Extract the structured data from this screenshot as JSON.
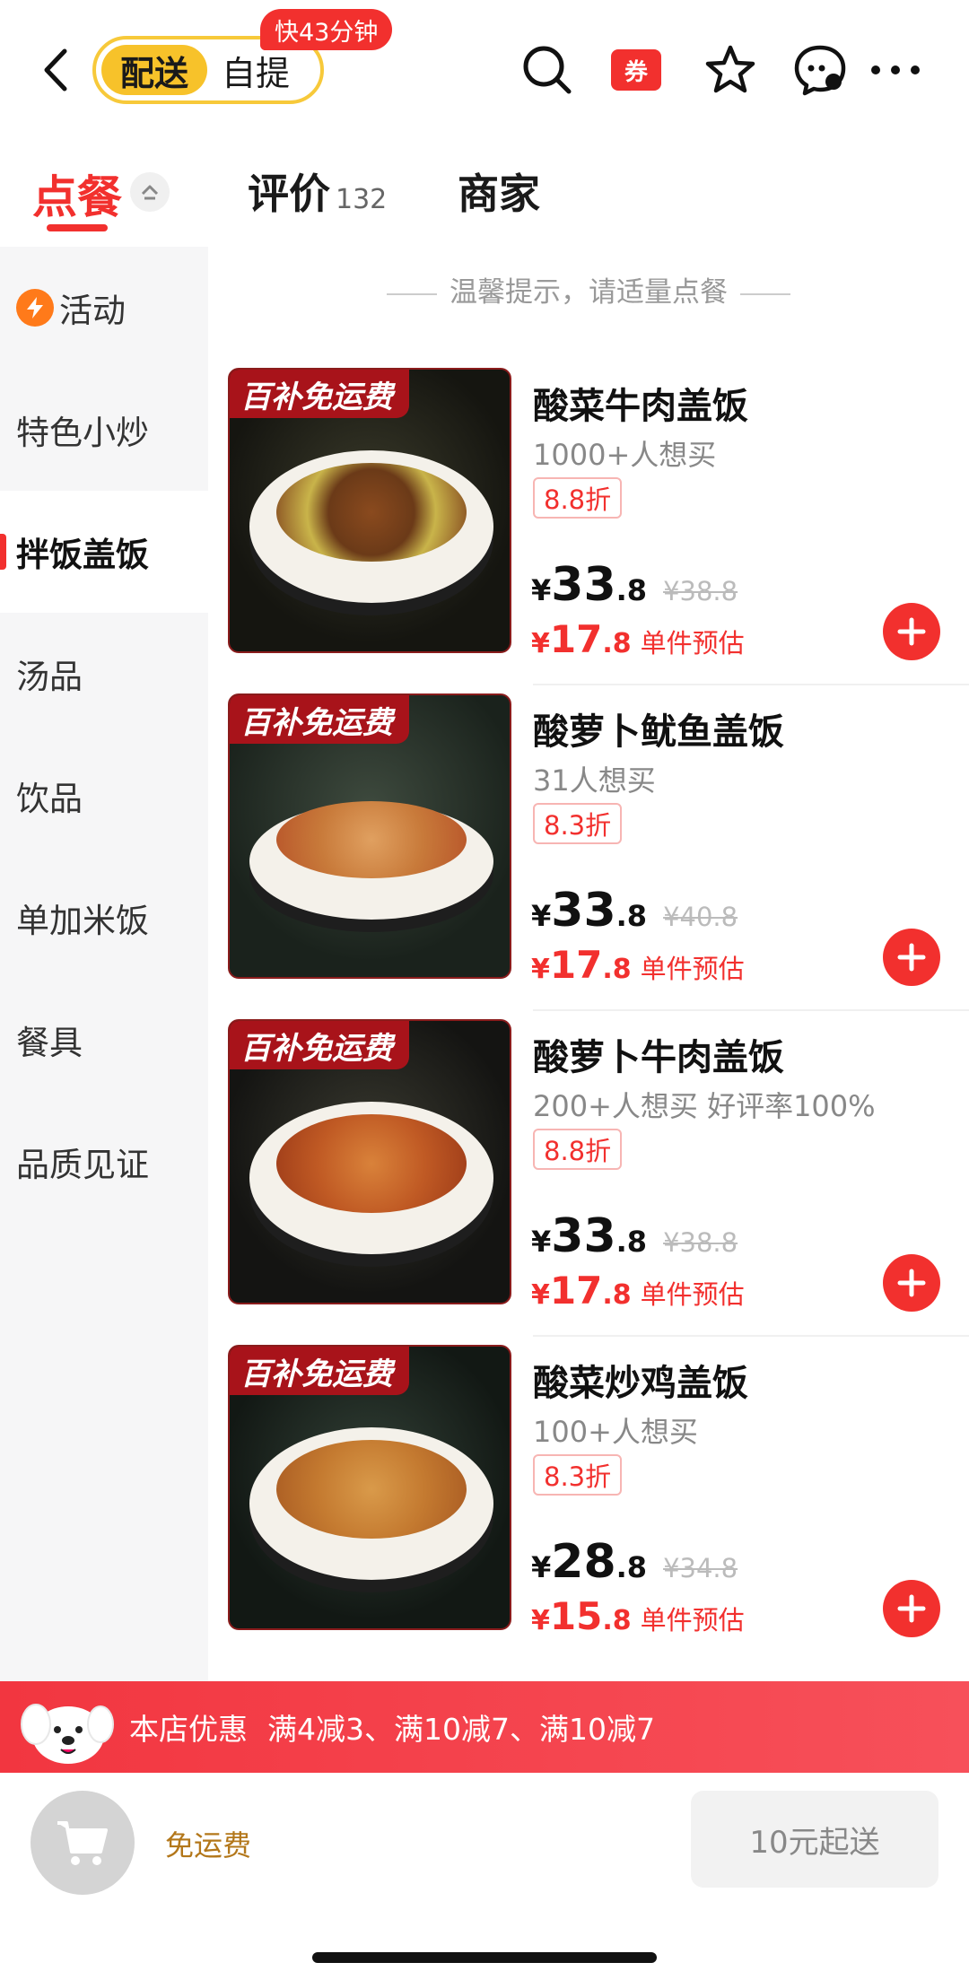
{
  "header": {
    "delivery_label": "配送",
    "pickup_label": "自提",
    "speed_badge": "快43分钟",
    "coupon_label": "券"
  },
  "tabs": {
    "order_label": "点餐",
    "reviews_label": "评价",
    "reviews_count": "132",
    "merchant_label": "商家"
  },
  "sidebar": {
    "items": [
      {
        "label": "活动"
      },
      {
        "label": "特色小炒"
      },
      {
        "label": "拌饭盖饭"
      },
      {
        "label": "汤品"
      },
      {
        "label": "饮品"
      },
      {
        "label": "单加米饭"
      },
      {
        "label": "餐具"
      },
      {
        "label": "品质见证"
      }
    ],
    "active": "拌饭盖饭"
  },
  "tip": "温馨提示，请适量点餐",
  "products": [
    {
      "promo_tag": "百补免运费",
      "name": "酸菜牛肉盖饭",
      "want": "1000+人想买",
      "discount": "8.8折",
      "price_yen": "¥",
      "price_int": "33",
      "price_dec": ".8",
      "orig_price": "¥38.8",
      "est_yen": "¥",
      "est_int": "17",
      "est_dec": ".8",
      "est_label": "单件预估"
    },
    {
      "promo_tag": "百补免运费",
      "name": "酸萝卜鱿鱼盖饭",
      "want": "31人想买",
      "discount": "8.3折",
      "price_yen": "¥",
      "price_int": "33",
      "price_dec": ".8",
      "orig_price": "¥40.8",
      "est_yen": "¥",
      "est_int": "17",
      "est_dec": ".8",
      "est_label": "单件预估"
    },
    {
      "promo_tag": "百补免运费",
      "name": "酸萝卜牛肉盖饭",
      "want": "200+人想买 好评率100%",
      "discount": "8.8折",
      "price_yen": "¥",
      "price_int": "33",
      "price_dec": ".8",
      "orig_price": "¥38.8",
      "est_yen": "¥",
      "est_int": "17",
      "est_dec": ".8",
      "est_label": "单件预估"
    },
    {
      "promo_tag": "百补免运费",
      "name": "酸菜炒鸡盖饭",
      "want": "100+人想买",
      "discount": "8.3折",
      "price_yen": "¥",
      "price_int": "28",
      "price_dec": ".8",
      "orig_price": "¥34.8",
      "est_yen": "¥",
      "est_int": "15",
      "est_dec": ".8",
      "est_label": "单件预估"
    }
  ],
  "promo_bar": {
    "label": "本店优惠",
    "rules": "满4减3、满10减7、满10减7"
  },
  "cart_bar": {
    "free_shipping": "免运费",
    "min_order": "10元起送"
  },
  "colors": {
    "accent_red": "#f2302e",
    "mode_yellow": "#f7c22a",
    "free_ship_text": "#b3771a"
  },
  "icons": [
    "back-arrow-icon",
    "search-icon",
    "coupon-icon",
    "star-icon",
    "chat-icon",
    "more-icon",
    "collapse-up-icon",
    "activity-icon",
    "plus-icon",
    "cart-icon"
  ]
}
